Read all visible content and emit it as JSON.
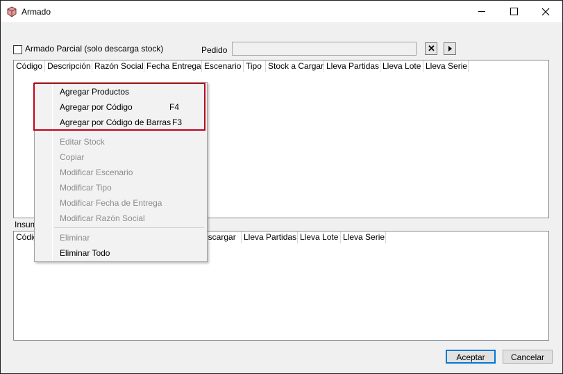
{
  "window": {
    "title": "Armado"
  },
  "form": {
    "partial_label": "Armado Parcial (solo descarga stock)",
    "pedido_label": "Pedido",
    "pedido_value": ""
  },
  "top_grid": {
    "columns": [
      "Código",
      "Descripción",
      "Razón Social",
      "Fecha Entrega",
      "Escenario",
      "Tipo",
      "Stock a Cargar",
      "Lleva Partidas",
      "Lleva Lote",
      "Lleva Serie"
    ]
  },
  "insumos_label": "Insum",
  "bottom_grid": {
    "columns": [
      "Códig",
      "escargar",
      "Lleva Partidas",
      "Lleva Lote",
      "Lleva Serie"
    ]
  },
  "context_menu": {
    "items": [
      {
        "label": "Agregar Productos",
        "shortcut": "",
        "enabled": true
      },
      {
        "label": "Agregar por Código",
        "shortcut": "F4",
        "enabled": true
      },
      {
        "label": "Agregar por Código de Barras",
        "shortcut": "F3",
        "enabled": true
      },
      {
        "label": "Editar Stock",
        "shortcut": "",
        "enabled": false
      },
      {
        "label": "Copiar",
        "shortcut": "",
        "enabled": false
      },
      {
        "label": "Modificar Escenario",
        "shortcut": "",
        "enabled": false
      },
      {
        "label": "Modificar Tipo",
        "shortcut": "",
        "enabled": false
      },
      {
        "label": "Modificar Fecha de Entrega",
        "shortcut": "",
        "enabled": false
      },
      {
        "label": "Modificar Razón Social",
        "shortcut": "",
        "enabled": false
      },
      {
        "label": "Eliminar",
        "shortcut": "",
        "enabled": false
      },
      {
        "label": "Eliminar Todo",
        "shortcut": "",
        "enabled": true
      }
    ]
  },
  "buttons": {
    "ok": "Aceptar",
    "cancel": "Cancelar"
  },
  "colors": {
    "highlight": "#c0001c",
    "accent": "#0078d7",
    "disabled_text": "#8d8d8d"
  }
}
